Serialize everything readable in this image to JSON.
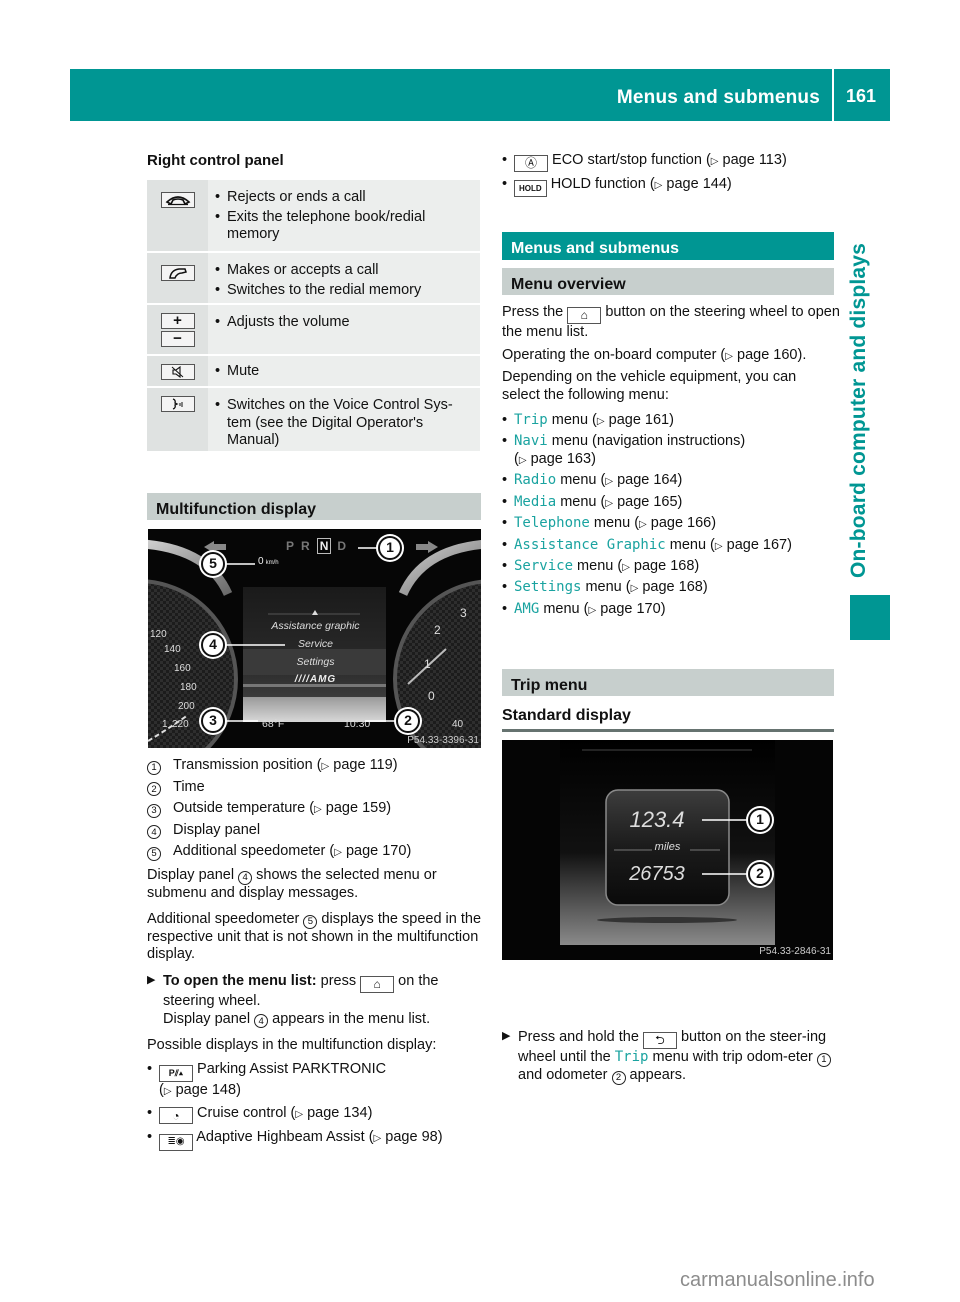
{
  "header": {
    "title": "Menus and submenus",
    "page_number": "161"
  },
  "side_tab": {
    "label": "On-board computer and displays"
  },
  "left": {
    "right_control_panel": {
      "heading": "Right control panel",
      "rows": [
        {
          "icon": "phone-hangup-icon",
          "glyph": "☎",
          "bullets": [
            "Rejects or ends a call",
            "Exits the telephone book/redial memory"
          ]
        },
        {
          "icon": "phone-accept-icon",
          "glyph": "✆",
          "bullets": [
            "Makes or accepts a call",
            "Switches to the redial memory"
          ]
        },
        {
          "icon": "volume-icon",
          "glyph_plus": "+",
          "glyph_minus": "−",
          "bullets": [
            "Adjusts the volume"
          ]
        },
        {
          "icon": "mute-icon",
          "glyph": "🔇︎",
          "bullets": [
            "Mute"
          ]
        },
        {
          "icon": "voice-control-icon",
          "glyph": "ʖ",
          "bullets": [
            "Switches on the Voice Control Sys-tem (see the Digital Operator's Manual)"
          ]
        }
      ]
    },
    "multifunction_display": {
      "heading": "Multifunction display",
      "figure": {
        "gear_letters": [
          "P",
          "R",
          "N",
          "D"
        ],
        "selected_gear": "N",
        "speed": "0",
        "speed_unit": "km/h",
        "menu_items": [
          "Assistance graphic",
          "Service",
          "Settings"
        ],
        "brand": "////AMG",
        "temperature": "68°F",
        "time": "10:30",
        "speedo_ticks": [
          "120",
          "140",
          "160",
          "180",
          "200",
          "220"
        ],
        "tacho_ticks": [
          "3",
          "2",
          "1",
          "0"
        ],
        "bottom_left": "1",
        "bottom_right": "40",
        "code": "P54.33-3396-31",
        "callouts": [
          "1",
          "2",
          "3",
          "4",
          "5"
        ]
      },
      "legend": [
        {
          "n": "1",
          "text": "Transmission position (",
          "ref": "page 119",
          "close": ")"
        },
        {
          "n": "2",
          "text": "Time",
          "ref": "",
          "close": ""
        },
        {
          "n": "3",
          "text": "Outside temperature (",
          "ref": "page 159",
          "close": ")"
        },
        {
          "n": "4",
          "text": "Display panel",
          "ref": "",
          "close": ""
        },
        {
          "n": "5",
          "text": "Additional speedometer (",
          "ref": "page 170",
          "close": ")"
        }
      ],
      "para1_a": "Display panel",
      "para1_n": "4",
      "para1_b": "shows the selected menu or submenu and display messages.",
      "para2_a": "Additional speedometer",
      "para2_n": "5",
      "para2_b": "displays the speed in the respective unit that is not shown in the multifunction display.",
      "instruction": {
        "bold": "To open the menu list:",
        "text_a": "press",
        "key": "⌂",
        "text_b": "on the steering wheel.",
        "line2_a": "Display panel",
        "line2_n": "4",
        "line2_b": "appears in the menu list."
      },
      "possible_heading": "Possible displays in the multifunction display:",
      "possible": [
        {
          "icon": "parktronic-icon",
          "key": "P⫽▴",
          "text": "Parking Assist PARKTRONIC",
          "ref": "page 148"
        },
        {
          "icon": "cruise-control-icon",
          "key": "◔",
          "text": "Cruise control (",
          "ref": "page 134"
        },
        {
          "icon": "highbeam-assist-icon",
          "key": "≣◉",
          "text": "Adaptive Highbeam Assist (",
          "ref": "page 98"
        }
      ]
    }
  },
  "right": {
    "top_bullets": [
      {
        "icon": "eco-start-stop-icon",
        "key": "Ⓐ",
        "text": "ECO start/stop function (",
        "ref": "page 113"
      },
      {
        "icon": "hold-icon",
        "key": "HOLD",
        "text": "HOLD function (",
        "ref": "page 144"
      }
    ],
    "section_title": "Menus and submenus",
    "menu_overview": {
      "heading": "Menu overview",
      "p1_a": "Press the",
      "p1_key": "⌂",
      "p1_b": "button on the steering wheel to open the menu list.",
      "p2_a": "Operating the on-board computer (",
      "p2_ref": "page 160",
      "p2_b": ").",
      "p3": "Depending on the vehicle equipment, you can select the following menu:",
      "menus": [
        {
          "name": "Trip",
          "desc": "menu (",
          "ref": "page 161",
          "extra": ""
        },
        {
          "name": "Navi",
          "desc": "menu (navigation instructions)",
          "ref": "page 163",
          "extra": "wrap"
        },
        {
          "name": "Radio",
          "desc": "menu (",
          "ref": "page 164",
          "extra": ""
        },
        {
          "name": "Media",
          "desc": "menu (",
          "ref": "page 165",
          "extra": ""
        },
        {
          "name": "Telephone",
          "desc": "menu (",
          "ref": "page 166",
          "extra": ""
        },
        {
          "name": "Assistance Graphic",
          "desc": "menu (",
          "ref": "page 167",
          "extra": ""
        },
        {
          "name": "Service",
          "desc": "menu (",
          "ref": "page 168",
          "extra": ""
        },
        {
          "name": "Settings",
          "desc": "menu (",
          "ref": "page 168",
          "extra": ""
        },
        {
          "name": "AMG",
          "desc": "menu (",
          "ref": "page 170",
          "extra": ""
        }
      ]
    },
    "trip_menu": {
      "heading": "Trip menu",
      "subheading": "Standard display",
      "figure": {
        "trip_value": "123.4",
        "unit": "miles",
        "odometer": "26753",
        "code": "P54.33-2846-31",
        "callouts": [
          "1",
          "2"
        ]
      },
      "instruction": {
        "text_a": "Press and hold the",
        "key": "⮌",
        "text_b": "button on the steer-ing wheel until the",
        "trip": "Trip",
        "text_c": "menu with trip odom-eter",
        "n1": "1",
        "text_d": "and odometer",
        "n2": "2",
        "text_e": "appears."
      }
    }
  },
  "colors": {
    "brand_teal": "#009693",
    "band_gray": "#c7cfcd",
    "menu_name": "#1aa3a0"
  },
  "watermark": "carmanualsonline.info"
}
